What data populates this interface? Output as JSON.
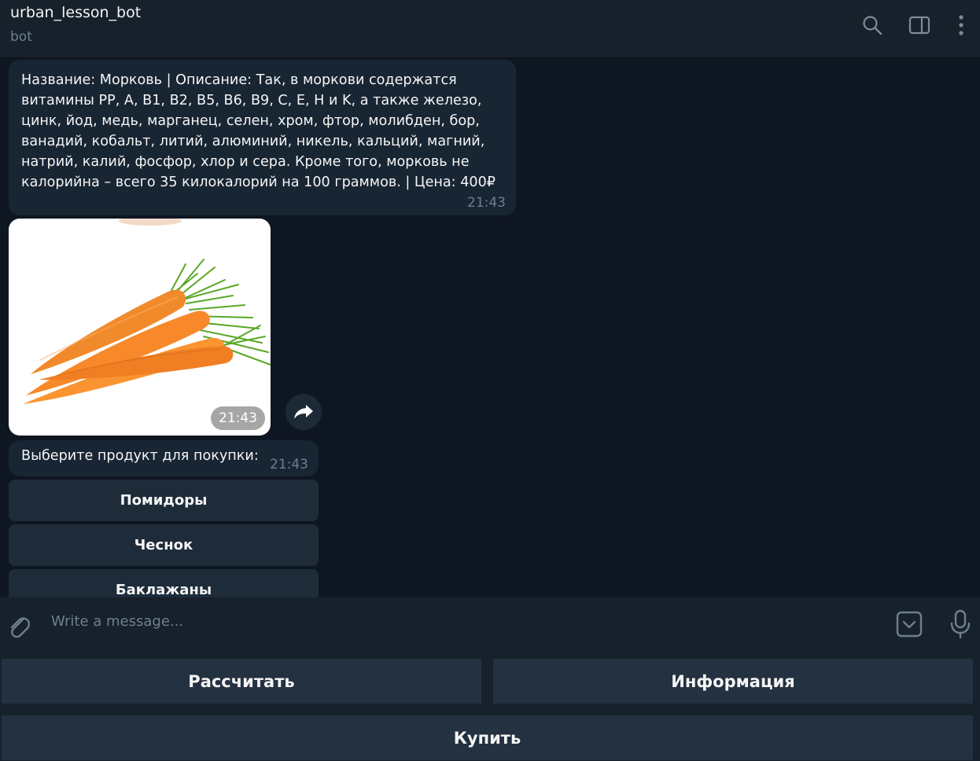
{
  "header": {
    "title": "urban_lesson_bot",
    "subtitle": "bot"
  },
  "messages": [
    {
      "text": "Название: Морковь | Описание: Так, в моркови содержатся витамины PP, A, B1, B2, B5, B6, B9, C, E, H и K, а также железо, цинк, йод, медь, марганец, селен, хром, фтор, молибден, бор, ванадий, кобальт, литий, алюминий, никель, кальций, магний, натрий, калий, фосфор, хлор и сера. Кроме того, морковь не калорийна – всего 35 килокалорий на 100 граммов. | Цена: 400₽",
      "time": "21:43"
    },
    {
      "photo_subject": "carrots",
      "time": "21:43"
    },
    {
      "text": "Выберите продукт для покупки:",
      "time": "21:43"
    }
  ],
  "inline_buttons": [
    "Помидоры",
    "Чеснок",
    "Баклажаны"
  ],
  "composer": {
    "placeholder": "Write a message..."
  },
  "reply_keyboard": {
    "row1": [
      "Рассчитать",
      "Информация"
    ],
    "row2": [
      "Купить"
    ]
  },
  "icons": {
    "header": [
      "search-icon",
      "sidebar-toggle-icon",
      "more-vertical-icon"
    ],
    "composer": [
      "attach-icon",
      "keyboard-toggle-icon",
      "microphone-icon"
    ],
    "message": [
      "share-icon"
    ]
  },
  "colors": {
    "background": "#0e1621",
    "panel": "#17212b",
    "bubble": "#182533",
    "muted_text": "#6d7f8f",
    "carrot": "#f7892a"
  }
}
